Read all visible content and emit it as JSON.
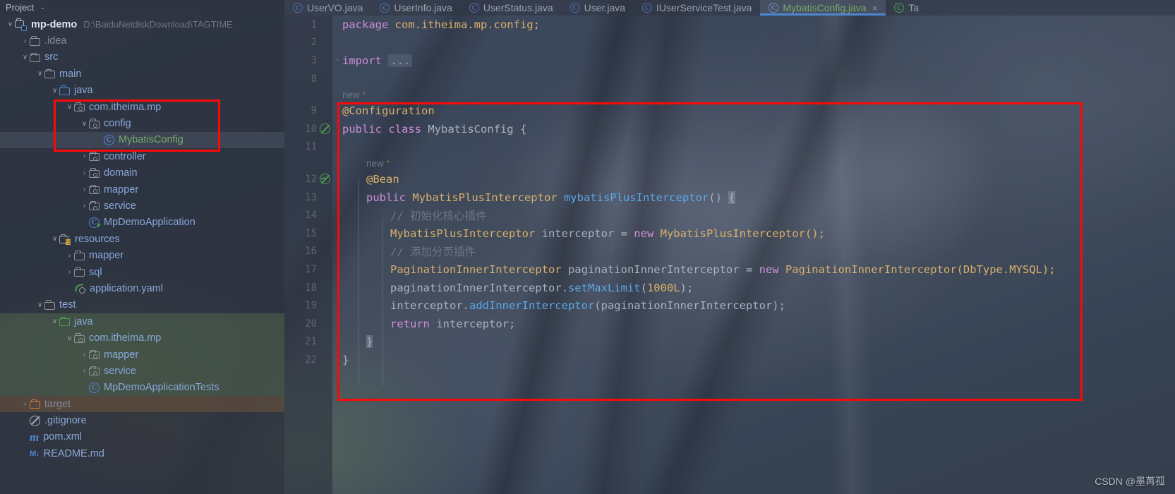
{
  "sidebar": {
    "header": {
      "title": "Project",
      "chevron": "⌄"
    },
    "tree": [
      {
        "indent": 0,
        "arrow": "∨",
        "icon": "module-icon",
        "label": "mp-demo",
        "sub": "D:\\BaiduNetdiskDownload\\TAGTIME",
        "style": "root"
      },
      {
        "indent": 1,
        "arrow": "›",
        "icon": "folder-icon",
        "label": ".idea",
        "style": "dim"
      },
      {
        "indent": 1,
        "arrow": "∨",
        "icon": "folder-icon",
        "label": "src",
        "style": "plain"
      },
      {
        "indent": 2,
        "arrow": "∨",
        "icon": "folder-icon",
        "label": "main",
        "style": "plain"
      },
      {
        "indent": 3,
        "arrow": "∨",
        "icon": "folder-blue-icon",
        "label": "java",
        "style": "plain"
      },
      {
        "indent": 4,
        "arrow": "∨",
        "icon": "package-icon",
        "label": "com.itheima.mp",
        "style": "plain"
      },
      {
        "indent": 5,
        "arrow": "∨",
        "icon": "package-icon",
        "label": "config",
        "style": "plain"
      },
      {
        "indent": 6,
        "arrow": "",
        "icon": "class-icon",
        "label": "MybatisConfig",
        "style": "selected"
      },
      {
        "indent": 5,
        "arrow": "›",
        "icon": "package-icon",
        "label": "controller",
        "style": "plain"
      },
      {
        "indent": 5,
        "arrow": "›",
        "icon": "package-icon",
        "label": "domain",
        "style": "plain"
      },
      {
        "indent": 5,
        "arrow": "›",
        "icon": "package-icon",
        "label": "mapper",
        "style": "plain"
      },
      {
        "indent": 5,
        "arrow": "›",
        "icon": "package-icon",
        "label": "service",
        "style": "plain"
      },
      {
        "indent": 5,
        "arrow": "",
        "icon": "class-run-icon",
        "label": "MpDemoApplication",
        "style": "plain"
      },
      {
        "indent": 3,
        "arrow": "∨",
        "icon": "resources-icon",
        "label": "resources",
        "style": "plain"
      },
      {
        "indent": 4,
        "arrow": "›",
        "icon": "folder-icon",
        "label": "mapper",
        "style": "plain"
      },
      {
        "indent": 4,
        "arrow": "›",
        "icon": "folder-icon",
        "label": "sql",
        "style": "plain"
      },
      {
        "indent": 4,
        "arrow": "",
        "icon": "yaml-icon",
        "label": "application.yaml",
        "style": "plain"
      },
      {
        "indent": 2,
        "arrow": "∨",
        "icon": "folder-icon",
        "label": "test",
        "style": "plain"
      },
      {
        "indent": 3,
        "arrow": "∨",
        "icon": "folder-green-icon",
        "label": "java",
        "style": "tint-green"
      },
      {
        "indent": 4,
        "arrow": "∨",
        "icon": "package-icon",
        "label": "com.itheima.mp",
        "style": "tint-green"
      },
      {
        "indent": 5,
        "arrow": "›",
        "icon": "package-icon",
        "label": "mapper",
        "style": "tint-green"
      },
      {
        "indent": 5,
        "arrow": "›",
        "icon": "package-icon",
        "label": "service",
        "style": "tint-green"
      },
      {
        "indent": 5,
        "arrow": "",
        "icon": "class-icon",
        "label": "MpDemoApplicationTests",
        "style": "tint-green"
      },
      {
        "indent": 1,
        "arrow": "›",
        "icon": "folder-orange-icon",
        "label": "target",
        "style": "tint-orange-dim"
      },
      {
        "indent": 1,
        "arrow": "",
        "icon": "gitignore-icon",
        "label": ".gitignore",
        "style": "plain"
      },
      {
        "indent": 1,
        "arrow": "",
        "icon": "maven-icon",
        "label": "pom.xml",
        "style": "plain"
      },
      {
        "indent": 1,
        "arrow": "",
        "icon": "markdown-icon",
        "label": "README.md",
        "style": "plain"
      }
    ]
  },
  "editor": {
    "tabs": [
      {
        "label": "UserVO.java",
        "active": false,
        "icon": "java-class-icon"
      },
      {
        "label": "UserInfo.java",
        "active": false,
        "icon": "java-class-icon"
      },
      {
        "label": "UserStatus.java",
        "active": false,
        "icon": "java-class-icon"
      },
      {
        "label": "User.java",
        "active": false,
        "icon": "java-class-icon"
      },
      {
        "label": "IUserServiceTest.java",
        "active": false,
        "icon": "java-class-icon"
      },
      {
        "label": "MybatisConfig.java",
        "active": true,
        "icon": "java-class-icon",
        "close": "×"
      },
      {
        "label": "Ta",
        "active": false,
        "icon": "java-class-green-icon"
      }
    ],
    "code": [
      {
        "type": "code",
        "num": "1",
        "gutter": "",
        "fold": "",
        "indent": 0,
        "tokens": [
          {
            "t": "package ",
            "c": "k"
          },
          {
            "t": "com.itheima.mp.config;",
            "c": "an"
          }
        ]
      },
      {
        "type": "code",
        "num": "2",
        "gutter": "",
        "fold": "",
        "indent": 0,
        "tokens": []
      },
      {
        "type": "code",
        "num": "3",
        "gutter": "",
        "fold": "›",
        "indent": 0,
        "tokens": [
          {
            "t": "import ",
            "c": "k"
          },
          {
            "t": "...",
            "c": "fold-chip"
          }
        ]
      },
      {
        "type": "code",
        "num": "8",
        "gutter": "",
        "fold": "",
        "indent": 0,
        "tokens": []
      },
      {
        "type": "hint",
        "num": "",
        "gutter": "",
        "fold": "",
        "indent": 0,
        "text": "new",
        "star": "*"
      },
      {
        "type": "code",
        "num": "9",
        "gutter": "",
        "fold": "",
        "indent": 0,
        "tokens": [
          {
            "t": "@Configuration",
            "c": "an"
          }
        ]
      },
      {
        "type": "code",
        "num": "10",
        "gutter": "bean-icon",
        "fold": "",
        "indent": 0,
        "tokens": [
          {
            "t": "public ",
            "c": "k"
          },
          {
            "t": "class ",
            "c": "k"
          },
          {
            "t": "MybatisConfig ",
            "c": "nm"
          },
          {
            "t": "{",
            "c": "nm"
          }
        ]
      },
      {
        "type": "code",
        "num": "11",
        "gutter": "",
        "fold": "",
        "indent": 0,
        "tokens": []
      },
      {
        "type": "hint",
        "num": "",
        "gutter": "",
        "fold": "",
        "indent": 1,
        "text": "new",
        "star": "*"
      },
      {
        "type": "code",
        "num": "12",
        "gutter": "bean-arrow-icon",
        "fold": "",
        "indent": 1,
        "tokens": [
          {
            "t": "@Bean",
            "c": "an"
          }
        ]
      },
      {
        "type": "code",
        "num": "13",
        "gutter": "",
        "fold": "",
        "indent": 1,
        "tokens": [
          {
            "t": "public ",
            "c": "k"
          },
          {
            "t": "MybatisPlusInterceptor ",
            "c": "an"
          },
          {
            "t": "mybatisPlusInterceptor",
            "c": "me"
          },
          {
            "t": "() ",
            "c": "nm"
          },
          {
            "t": "{",
            "c": "cursor"
          }
        ]
      },
      {
        "type": "code",
        "num": "14",
        "gutter": "",
        "fold": "",
        "indent": 2,
        "tokens": [
          {
            "t": "// 初始化核心插件",
            "c": "cm"
          }
        ]
      },
      {
        "type": "code",
        "num": "15",
        "gutter": "",
        "fold": "",
        "indent": 2,
        "tokens": [
          {
            "t": "MybatisPlusInterceptor ",
            "c": "an"
          },
          {
            "t": "interceptor ",
            "c": "nm"
          },
          {
            "t": "= ",
            "c": "nm"
          },
          {
            "t": "new ",
            "c": "k"
          },
          {
            "t": "MybatisPlusInterceptor();",
            "c": "an"
          }
        ]
      },
      {
        "type": "code",
        "num": "16",
        "gutter": "",
        "fold": "",
        "indent": 2,
        "tokens": [
          {
            "t": "// 添加分页插件",
            "c": "cm"
          }
        ]
      },
      {
        "type": "code",
        "num": "17",
        "gutter": "",
        "fold": "",
        "indent": 2,
        "tokens": [
          {
            "t": "PaginationInnerInterceptor ",
            "c": "an"
          },
          {
            "t": "paginationInnerInterceptor ",
            "c": "nm"
          },
          {
            "t": "= ",
            "c": "nm"
          },
          {
            "t": "new ",
            "c": "k"
          },
          {
            "t": "PaginationInnerInterceptor(DbType.MYSQL);",
            "c": "an"
          }
        ]
      },
      {
        "type": "code",
        "num": "18",
        "gutter": "",
        "fold": "",
        "indent": 2,
        "tokens": [
          {
            "t": "paginationInnerInterceptor.",
            "c": "nm"
          },
          {
            "t": "setMaxLimit",
            "c": "me"
          },
          {
            "t": "(",
            "c": "nm"
          },
          {
            "t": "1000L",
            "c": "an"
          },
          {
            "t": ");",
            "c": "nm"
          }
        ]
      },
      {
        "type": "code",
        "num": "19",
        "gutter": "",
        "fold": "",
        "indent": 2,
        "tokens": [
          {
            "t": "interceptor.",
            "c": "nm"
          },
          {
            "t": "addInnerInterceptor",
            "c": "me"
          },
          {
            "t": "(paginationInnerInterceptor);",
            "c": "nm"
          }
        ]
      },
      {
        "type": "code",
        "num": "20",
        "gutter": "",
        "fold": "",
        "indent": 2,
        "tokens": [
          {
            "t": "return ",
            "c": "k"
          },
          {
            "t": "interceptor;",
            "c": "nm"
          }
        ]
      },
      {
        "type": "code",
        "num": "21",
        "gutter": "",
        "fold": "",
        "indent": 1,
        "tokens": [
          {
            "t": "}",
            "c": "cursor"
          }
        ]
      },
      {
        "type": "code",
        "num": "22",
        "gutter": "",
        "fold": "",
        "indent": 0,
        "tokens": [
          {
            "t": "}",
            "c": "nm"
          }
        ]
      }
    ]
  },
  "annotations": {
    "box_color": "#fb0808",
    "tree_box_target": "config / MybatisConfig",
    "code_box_target": "MybatisConfig class body"
  },
  "watermark": "CSDN @墨苒孤"
}
